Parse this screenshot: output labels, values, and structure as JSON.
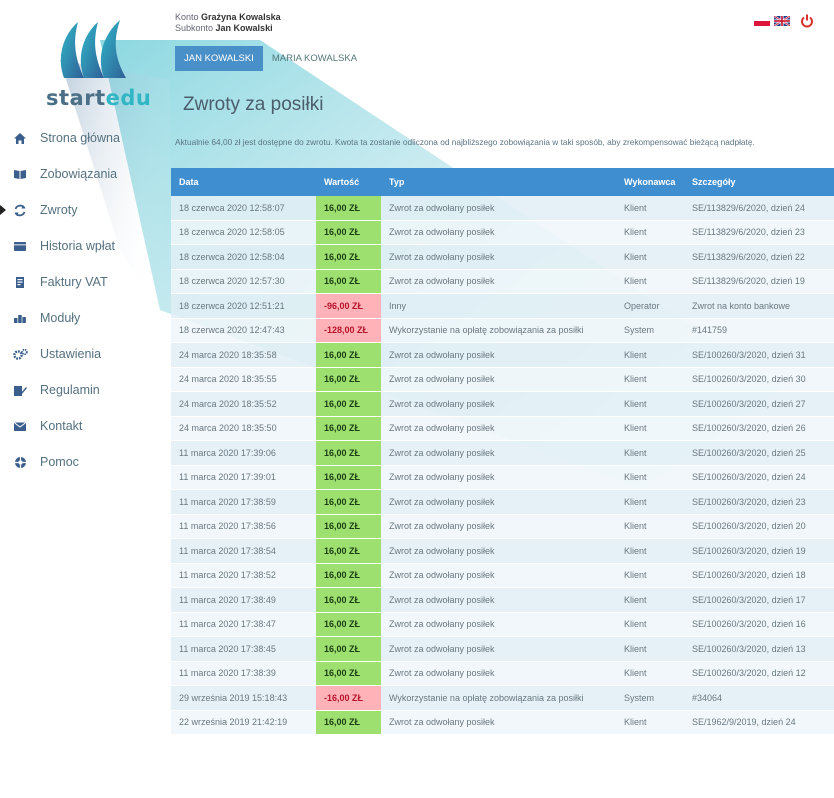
{
  "account": {
    "konto_label": "Konto",
    "konto_name": "Grażyna Kowalska",
    "subkonto_label": "Subkonto",
    "subkonto_name": "Jan Kowalski"
  },
  "tabs": [
    {
      "label": "JAN KOWALSKI",
      "active": true
    },
    {
      "label": "MARIA KOWALSKA",
      "active": false
    }
  ],
  "logo": {
    "part1": "start",
    "part2": "edu"
  },
  "sidebar": {
    "items": [
      {
        "label": "Strona główna",
        "icon": "home-icon"
      },
      {
        "label": "Zobowiązania",
        "icon": "book-icon"
      },
      {
        "label": "Zwroty",
        "icon": "refresh-icon",
        "active": true
      },
      {
        "label": "Historia wpłat",
        "icon": "wallet-icon"
      },
      {
        "label": "Faktury VAT",
        "icon": "invoice-icon"
      },
      {
        "label": "Moduły",
        "icon": "modules-icon"
      },
      {
        "label": "Ustawienia",
        "icon": "gears-icon"
      },
      {
        "label": "Regulamin",
        "icon": "edit-icon"
      },
      {
        "label": "Kontakt",
        "icon": "envelope-icon"
      },
      {
        "label": "Pomoc",
        "icon": "help-icon"
      }
    ]
  },
  "page": {
    "title": "Zwroty za posiłki",
    "notice": "Aktualnie 64,00 zł jest dostępne do zwrotu. Kwota ta zostanie odliczona od najbliższego zobowiązania w taki sposób, aby zrekompensować bieżącą nadpłatę."
  },
  "colors": {
    "accent": "#3f8fd0",
    "positive": "#9ee06f",
    "negative": "#ffb3b8",
    "power": "#d9302b"
  },
  "table": {
    "headers": [
      "Data",
      "Wartość",
      "Typ",
      "Wykonawca",
      "Szczegóły"
    ],
    "rows": [
      [
        "18 czerwca 2020 12:58:07",
        "16,00 ZŁ",
        "Zwrot za odwołany posiłek",
        "Klient",
        "SE/113829/6/2020, dzień 24",
        "pos"
      ],
      [
        "18 czerwca 2020 12:58:05",
        "16,00 ZŁ",
        "Zwrot za odwołany posiłek",
        "Klient",
        "SE/113829/6/2020, dzień 23",
        "pos"
      ],
      [
        "18 czerwca 2020 12:58:04",
        "16,00 ZŁ",
        "Zwrot za odwołany posiłek",
        "Klient",
        "SE/113829/6/2020, dzień 22",
        "pos"
      ],
      [
        "18 czerwca 2020 12:57:30",
        "16,00 ZŁ",
        "Zwrot za odwołany posiłek",
        "Klient",
        "SE/113829/6/2020, dzień 19",
        "pos"
      ],
      [
        "18 czerwca 2020 12:51:21",
        "-96,00 ZŁ",
        "Inny",
        "Operator",
        "Zwrot na konto bankowe",
        "neg"
      ],
      [
        "18 czerwca 2020 12:47:43",
        "-128,00 ZŁ",
        "Wykorzystanie na opłatę zobowiązania za posiłki",
        "System",
        "#141759",
        "neg"
      ],
      [
        "24 marca 2020 18:35:58",
        "16,00 ZŁ",
        "Zwrot za odwołany posiłek",
        "Klient",
        "SE/100260/3/2020, dzień 31",
        "pos"
      ],
      [
        "24 marca 2020 18:35:55",
        "16,00 ZŁ",
        "Zwrot za odwołany posiłek",
        "Klient",
        "SE/100260/3/2020, dzień 30",
        "pos"
      ],
      [
        "24 marca 2020 18:35:52",
        "16,00 ZŁ",
        "Zwrot za odwołany posiłek",
        "Klient",
        "SE/100260/3/2020, dzień 27",
        "pos"
      ],
      [
        "24 marca 2020 18:35:50",
        "16,00 ZŁ",
        "Zwrot za odwołany posiłek",
        "Klient",
        "SE/100260/3/2020, dzień 26",
        "pos"
      ],
      [
        "11 marca 2020 17:39:06",
        "16,00 ZŁ",
        "Zwrot za odwołany posiłek",
        "Klient",
        "SE/100260/3/2020, dzień 25",
        "pos"
      ],
      [
        "11 marca 2020 17:39:01",
        "16,00 ZŁ",
        "Zwrot za odwołany posiłek",
        "Klient",
        "SE/100260/3/2020, dzień 24",
        "pos"
      ],
      [
        "11 marca 2020 17:38:59",
        "16,00 ZŁ",
        "Zwrot za odwołany posiłek",
        "Klient",
        "SE/100260/3/2020, dzień 23",
        "pos"
      ],
      [
        "11 marca 2020 17:38:56",
        "16,00 ZŁ",
        "Zwrot za odwołany posiłek",
        "Klient",
        "SE/100260/3/2020, dzień 20",
        "pos"
      ],
      [
        "11 marca 2020 17:38:54",
        "16,00 ZŁ",
        "Zwrot za odwołany posiłek",
        "Klient",
        "SE/100260/3/2020, dzień 19",
        "pos"
      ],
      [
        "11 marca 2020 17:38:52",
        "16,00 ZŁ",
        "Zwrot za odwołany posiłek",
        "Klient",
        "SE/100260/3/2020, dzień 18",
        "pos"
      ],
      [
        "11 marca 2020 17:38:49",
        "16,00 ZŁ",
        "Zwrot za odwołany posiłek",
        "Klient",
        "SE/100260/3/2020, dzień 17",
        "pos"
      ],
      [
        "11 marca 2020 17:38:47",
        "16,00 ZŁ",
        "Zwrot za odwołany posiłek",
        "Klient",
        "SE/100260/3/2020, dzień 16",
        "pos"
      ],
      [
        "11 marca 2020 17:38:45",
        "16,00 ZŁ",
        "Zwrot za odwołany posiłek",
        "Klient",
        "SE/100260/3/2020, dzień 13",
        "pos"
      ],
      [
        "11 marca 2020 17:38:39",
        "16,00 ZŁ",
        "Zwrot za odwołany posiłek",
        "Klient",
        "SE/100260/3/2020, dzień 12",
        "pos"
      ],
      [
        "29 września 2019 15:18:43",
        "-16,00 ZŁ",
        "Wykorzystanie na opłatę zobowiązania za posiłki",
        "System",
        "#34064",
        "neg"
      ],
      [
        "22 września 2019 21:42:19",
        "16,00 ZŁ",
        "Zwrot za odwołany posiłek",
        "Klient",
        "SE/1962/9/2019, dzień 24",
        "pos"
      ]
    ]
  }
}
